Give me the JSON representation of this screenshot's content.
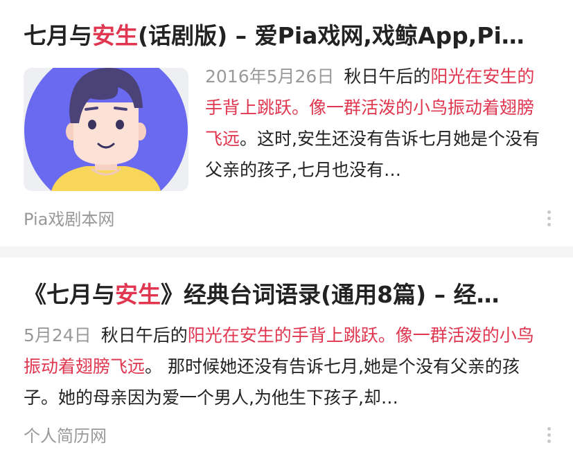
{
  "results": [
    {
      "title_parts": [
        "七月与",
        "安生",
        "(话剧版) – 爱Pia戏网,戏鲸App,Pi…"
      ],
      "date": "2016年5月26日",
      "snippet_parts": [
        "秋日午后的",
        "阳光在安生的手背上跳跃。像一群活泼的小鸟振动着翅膀飞远",
        "。这时,安生还没有告诉七月她是个没有父亲的孩子,七月也没有…"
      ],
      "source": "Pia戏剧本网",
      "thumbnail_icon": "boy-avatar-illustration-icon",
      "more_icon": "more-vertical-icon"
    },
    {
      "title_parts": [
        "《七月与",
        "安生",
        "》经典台词语录(通用8篇) – 经…"
      ],
      "date": "5月24日",
      "snippet_parts": [
        "秋日午后的",
        "阳光在安生的手背上跳跃。像一群活泼的小鸟振动着翅膀飞远",
        "。 那时候她还没有告诉七月,她是个没有父亲的孩子。她的母亲因为爱一个男人,为他生下孩子,却…"
      ],
      "source": "个人简历网",
      "more_icon": "more-vertical-icon"
    }
  ],
  "colors": {
    "highlight": "#e0364f",
    "meta": "#999999",
    "divider": "#f5f5f6",
    "avatar_bg": "#6a6af0"
  }
}
